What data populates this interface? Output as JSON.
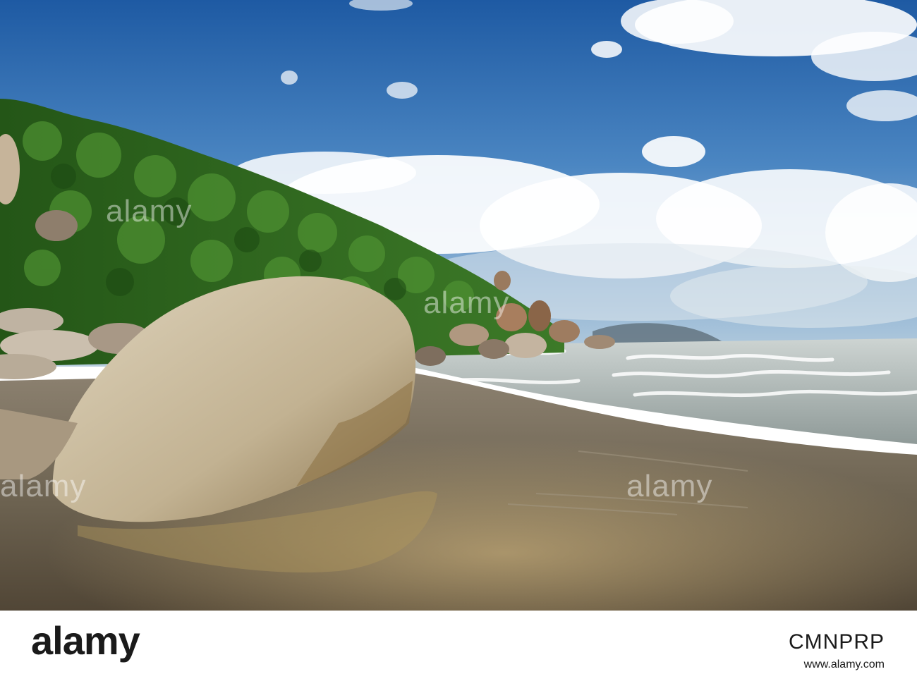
{
  "watermark": {
    "text": "alamy"
  },
  "footer": {
    "logo_text": "alamy",
    "image_code": "CMNPRP",
    "site": "www.alamy.com"
  },
  "colors": {
    "sky_top": "#1f5fa6",
    "sky_bottom": "#9cc0de",
    "hill": "#2e6a1f",
    "boulder": "#c9b99a",
    "sand": "#7a6b55",
    "sea": "#b8c4c8"
  }
}
